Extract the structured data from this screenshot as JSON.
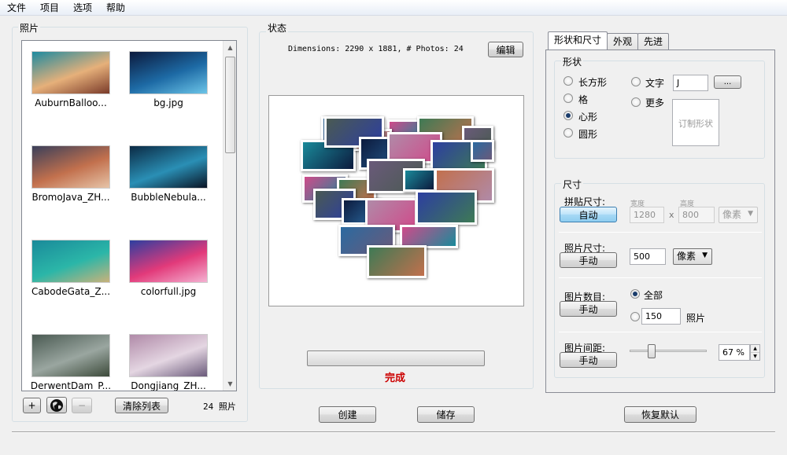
{
  "menu": [
    "文件",
    "项目",
    "选项",
    "帮助"
  ],
  "photos_panel": {
    "title": "照片",
    "items": [
      {
        "label": "AuburnBalloo...",
        "colors": [
          "#1d8aa0",
          "#e6b07a",
          "#7a3b2a"
        ]
      },
      {
        "label": "bg.jpg",
        "colors": [
          "#0c1a3d",
          "#1d6aa5",
          "#6cc5e8"
        ]
      },
      {
        "label": "BromoJava_ZH...",
        "colors": [
          "#3a3f5a",
          "#c2704d",
          "#e6c4a8"
        ]
      },
      {
        "label": "BubbleNebula...",
        "colors": [
          "#0b2a44",
          "#2a8fb5",
          "#0a1424"
        ]
      },
      {
        "label": "CabodeGata_Z...",
        "colors": [
          "#1a8a9a",
          "#2bb6a8",
          "#c9b27a"
        ]
      },
      {
        "label": "colorfull.jpg",
        "colors": [
          "#2d3ea0",
          "#e23a7a",
          "#f4b2d2"
        ]
      },
      {
        "label": "DerwentDam_P...",
        "colors": [
          "#4a5a52",
          "#9aa6a0",
          "#3c4a3a"
        ]
      },
      {
        "label": "Dongjiang_ZH...",
        "colors": [
          "#b08aa8",
          "#e4d6e2",
          "#6a5a7a"
        ]
      }
    ],
    "add_label": "+",
    "globe_icon": "globe-icon",
    "remove_label": "−",
    "clear_label": "清除列表",
    "count_text": "24 照片"
  },
  "status_panel": {
    "title": "状态",
    "dimensions_text": "Dimensions: 2290 x 1881, # Photos: 24",
    "edit_label": "编辑",
    "done_text": "完成",
    "done_color": "#cc0000"
  },
  "tabs": [
    {
      "label": "形状和尺寸",
      "active": true
    },
    {
      "label": "外观",
      "active": false
    },
    {
      "label": "先进",
      "active": false
    }
  ],
  "shape_group": {
    "title": "形状",
    "options": [
      {
        "label": "长方形",
        "selected": false
      },
      {
        "label": "格",
        "selected": false
      },
      {
        "label": "心形",
        "selected": true
      },
      {
        "label": "圆形",
        "selected": false
      }
    ],
    "text_option": {
      "label": "文字",
      "selected": false,
      "value": "J",
      "browse_label": "..."
    },
    "more_option": {
      "label": "更多",
      "selected": false
    },
    "custom_shape_label": "订制形状"
  },
  "size_group": {
    "title": "尺寸",
    "collage_size": {
      "label": "拼贴尺寸:",
      "button": "自动",
      "width_label": "宽度",
      "width_value": "1280",
      "x_label": "x",
      "height_label": "高度",
      "height_value": "800",
      "unit": "像素"
    },
    "photo_size": {
      "label": "照片尺寸:",
      "button": "手动",
      "value": "500",
      "unit": "像素"
    },
    "photo_count": {
      "label": "图片数目:",
      "button": "手动",
      "all_label": "全部",
      "all_selected": true,
      "custom_value": "150",
      "custom_unit": "照片"
    },
    "spacing": {
      "label": "图片间距:",
      "button": "手动",
      "value": "67",
      "unit": "%",
      "slider_fraction": 0.26
    }
  },
  "bottom_buttons": {
    "create": "创建",
    "save": "储存",
    "restore": "恢复默认"
  }
}
